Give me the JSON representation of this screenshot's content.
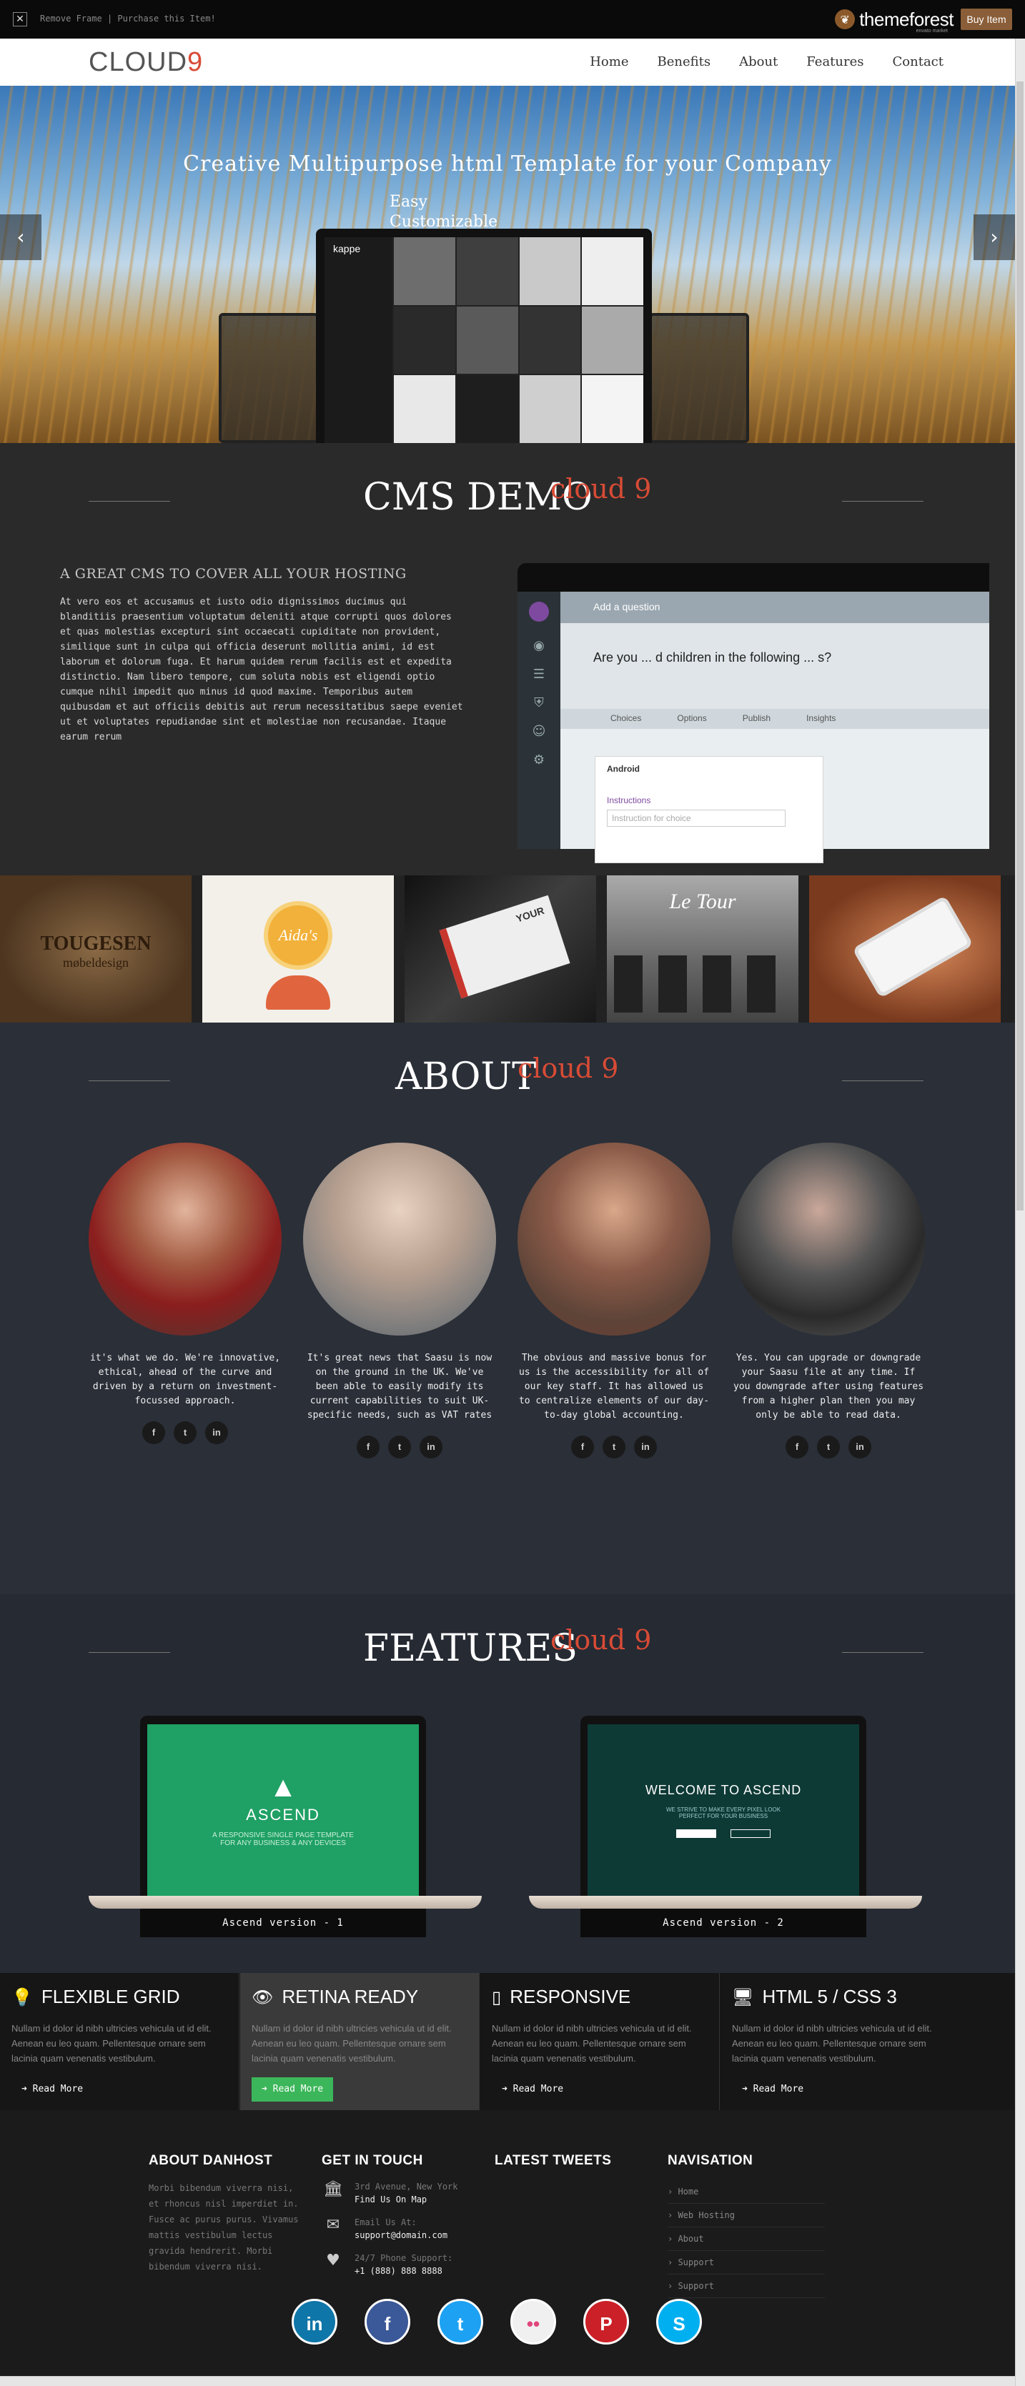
{
  "topbar": {
    "remove_frame": "Remove Frame",
    "separator": "|",
    "purchase": "Purchase this Item!",
    "brand": "themeforest",
    "brand_sub": "envato market",
    "buy": "Buy Item"
  },
  "nav": {
    "logo_main": "CLOUD",
    "logo_accent": "9",
    "items": [
      "Home",
      "Benefits",
      "About",
      "Features",
      "Contact"
    ]
  },
  "hero": {
    "title": "Creative Multipurpose html Template for your Company",
    "line1": "Easy",
    "line2": "Customizable",
    "screen_brand": "kappe",
    "prev": "‹",
    "next": "›"
  },
  "cms": {
    "title": "CMS DEMO",
    "accent": "cloud 9",
    "heading": "A GREAT CMS TO COVER ALL YOUR HOSTING",
    "body": "At vero eos et accusamus et iusto odio dignissimos ducimus qui blanditiis praesentium voluptatum deleniti atque corrupti quos dolores et quas molestias excepturi sint occaecati cupiditate non provident, similique sunt in culpa qui officia deserunt mollitia animi, id est laborum et dolorum fuga. Et harum quidem rerum facilis est et expedita distinctio. Nam libero tempore, cum soluta nobis est eligendi optio cumque nihil impedit quo minus id quod maxime. Temporibus autem quibusdam et aut officiis debitis aut rerum necessitatibus saepe eveniet ut et voluptates repudiandae sint et molestiae non recusandae. Itaque earum rerum",
    "app_header": "Add a question",
    "app_question": "Are you ... d children in the following ... s?",
    "app_tabs": [
      "Choices",
      "Options",
      "Publish",
      "Insights"
    ],
    "app_card_title": "Android",
    "app_card_label": "Instructions",
    "app_card_placeholder": "Instruction for choice"
  },
  "gallery": {
    "items": [
      {
        "caption": "TOUGESEN",
        "sub": "møbeldesign",
        "color": "#6b4a2a"
      },
      {
        "caption": "Aida's",
        "sub": "",
        "color": "#e9b248"
      },
      {
        "caption": "YOUR",
        "sub": "",
        "color": "#3a3a3a"
      },
      {
        "caption": "Le Tour",
        "sub": "",
        "color": "#6b6b6b"
      },
      {
        "caption": "",
        "sub": "",
        "color": "#8a4a2a"
      }
    ]
  },
  "about": {
    "title": "ABOUT",
    "accent": "cloud 9",
    "people": [
      {
        "desc": "it's what we do. We're innovative, ethical, ahead of the curve and driven by a return on investment-focussed approach.",
        "color": "#8a4a3e"
      },
      {
        "desc": "It's great news that Saasu is now on the ground in the UK. We've been able to easily modify its current capabilities to suit UK-specific needs, such as VAT rates",
        "color": "#7a7a7a"
      },
      {
        "desc": "The obvious and massive bonus for us is the accessibility for all of our key staff. It has allowed us to centralize elements of our day-to-day global accounting.",
        "color": "#6a4a3a"
      },
      {
        "desc": "Yes. You can upgrade or downgrade your Saasu file at any time. If you downgrade after using features from a higher plan then you may only be able to read data.",
        "color": "#555555"
      }
    ],
    "social": [
      "f",
      "t",
      "in"
    ]
  },
  "features": {
    "title": "FEATURES",
    "accent": "cloud 9",
    "laptops": [
      {
        "caption": "Ascend version - 1",
        "brand": "ASCEND",
        "tagline": "A RESPONSIVE SINGLE PAGE TEMPLATE FOR ANY BUSINESS & ANY DEVICES",
        "bg": "#1fa064"
      },
      {
        "caption": "Ascend version - 2",
        "brand": "WELCOME TO ASCEND",
        "tagline": "WE STRIVE TO MAKE EVERY PIXEL LOOK PERFECT FOR YOUR BUSINESS",
        "bg": "#0e3a36"
      }
    ]
  },
  "boxes": [
    {
      "icon": "💡",
      "title": "FLEXIBLE GRID",
      "body": "Nullam id dolor id nibh ultricies vehicula ut id elit. Aenean eu leo quam. Pellentesque ornare sem lacinia quam venenatis vestibulum.",
      "more": "Read More"
    },
    {
      "icon": "👁",
      "title": "RETINA READY",
      "body": "Nullam id dolor id nibh ultricies vehicula ut id elit. Aenean eu leo quam. Pellentesque ornare sem lacinia quam venenatis vestibulum.",
      "more": "Read More"
    },
    {
      "icon": "▯",
      "title": "RESPONSIVE",
      "body": "Nullam id dolor id nibh ultricies vehicula ut id elit. Aenean eu leo quam. Pellentesque ornare sem lacinia quam venenatis vestibulum.",
      "more": "Read More"
    },
    {
      "icon": "🖥",
      "title": "HTML 5 / CSS 3",
      "body": "Nullam id dolor id nibh ultricies vehicula ut id elit. Aenean eu leo quam. Pellentesque ornare sem lacinia quam venenatis vestibulum.",
      "more": "Read More"
    }
  ],
  "footer": {
    "about_title": "ABOUT DANHOST",
    "about_body": "Morbi bibendum viverra nisi, et rhoncus nisl imperdiet in. Fusce ac purus purus. Vivamus mattis vestibulum lectus gravida hendrerit. Morbi bibendum viverra nisi.",
    "touch_title": "GET IN TOUCH",
    "contacts": [
      {
        "icon": "🏛",
        "line1": "3rd Avenue, New York",
        "line2": "Find Us On Map"
      },
      {
        "icon": "✉",
        "line1": "Email Us At:",
        "line2": "support@domain.com"
      },
      {
        "icon": "♥",
        "line1": "24/7 Phone Support:",
        "line2": "+1 (888) 888 8888"
      }
    ],
    "tweets_title": "LATEST TWEETS",
    "nav_title": "NAVISATION",
    "nav_items": [
      "Home",
      "Web Hosting",
      "About",
      "Support",
      "Support"
    ],
    "social": [
      {
        "label": "in",
        "color": "#0e76a8"
      },
      {
        "label": "f",
        "color": "#3b5998"
      },
      {
        "label": "t",
        "color": "#1da1f2"
      },
      {
        "label": "••",
        "color": "#f0f0f0"
      },
      {
        "label": "P",
        "color": "#cb2027"
      },
      {
        "label": "S",
        "color": "#00aff0"
      }
    ]
  }
}
